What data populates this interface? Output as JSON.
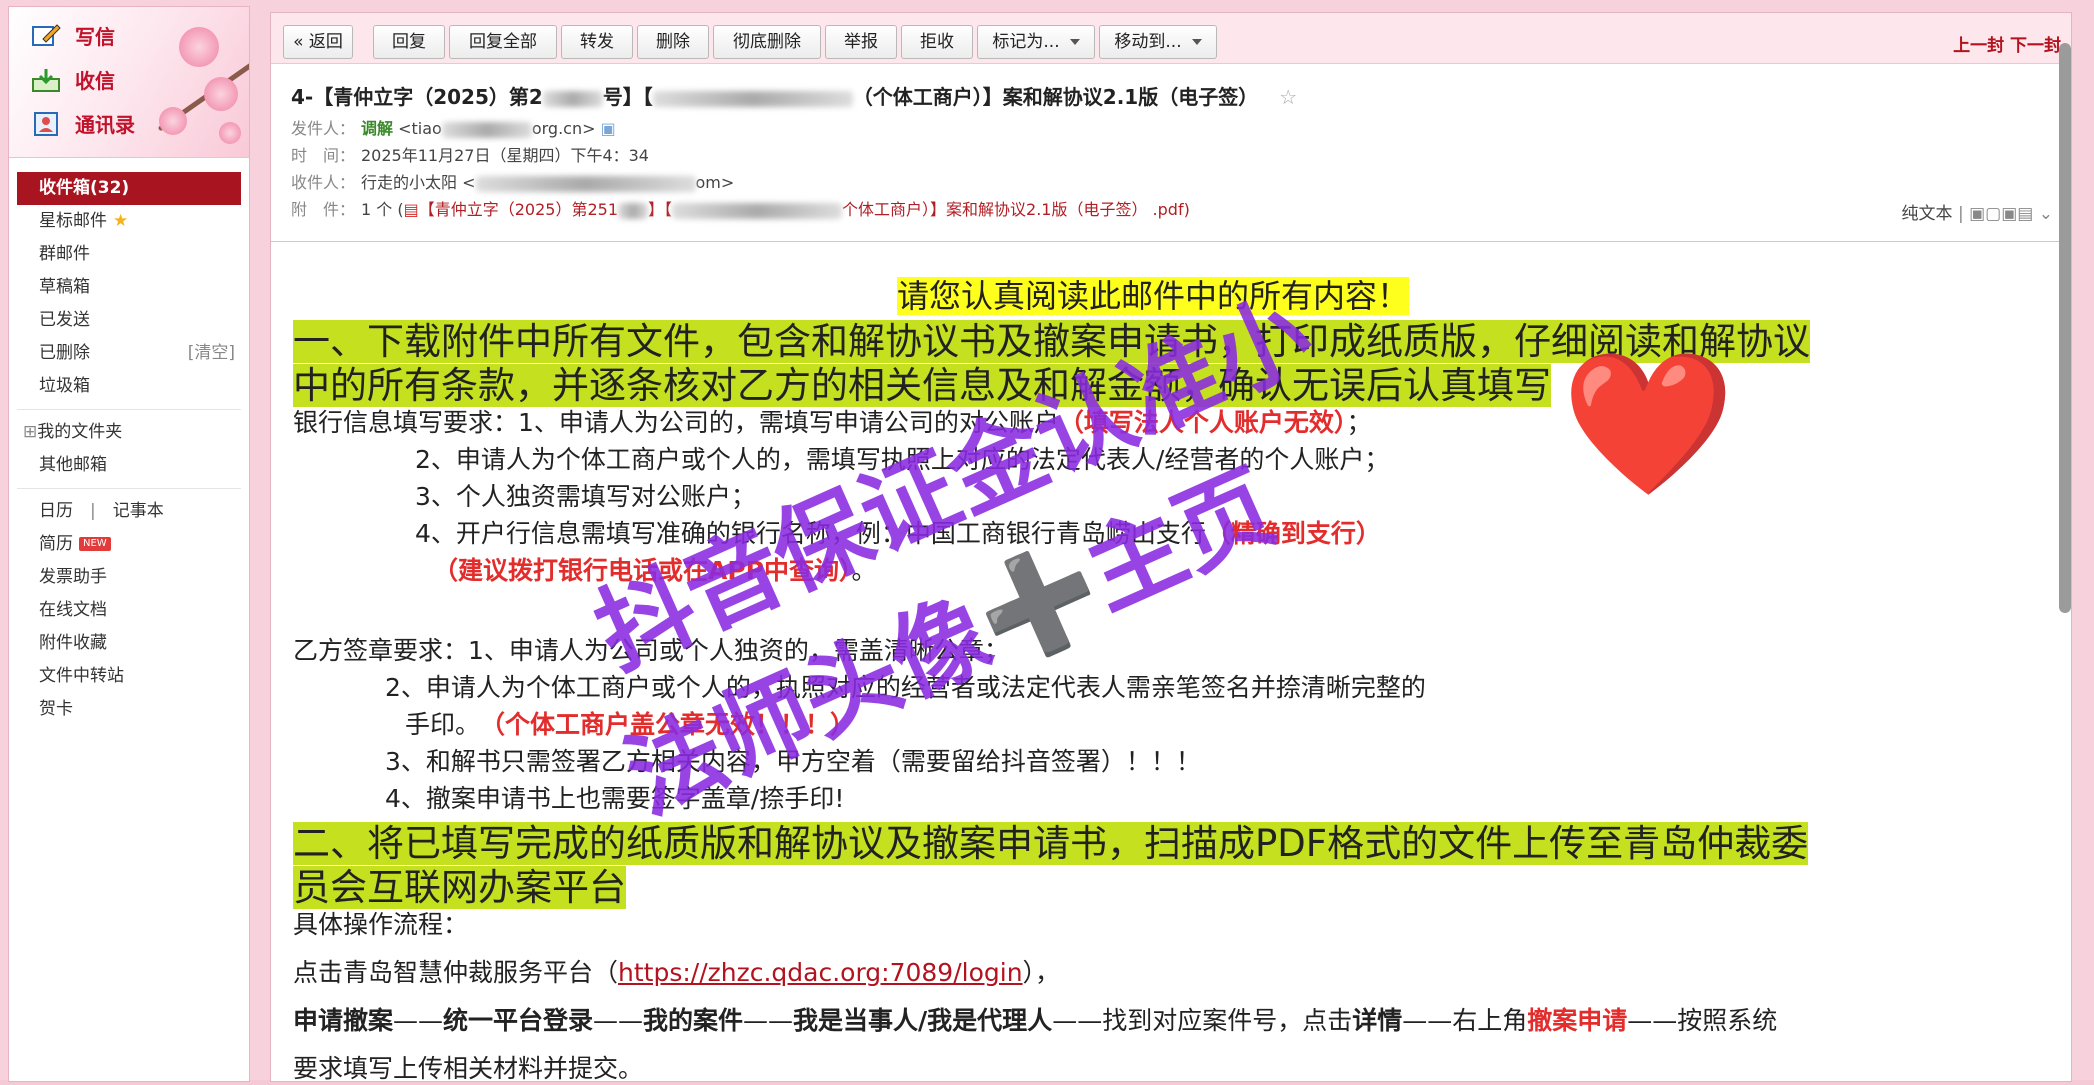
{
  "sidebar": {
    "write": "写信",
    "inbox": "收信",
    "contacts": "通讯录",
    "folders": [
      {
        "label": "收件箱(32)",
        "active": true
      },
      {
        "label": "星标邮件"
      },
      {
        "label": "群邮件"
      },
      {
        "label": "草稿箱"
      },
      {
        "label": "已发送"
      },
      {
        "label": "已删除",
        "extra": "[清空]"
      },
      {
        "label": "垃圾箱"
      }
    ],
    "my_folders": "我的文件夹",
    "other_mail": "其他邮箱",
    "calendar": "日历",
    "notes": "记事本",
    "resume": "简历",
    "resume_badge": "NEW",
    "tools": [
      "发票助手",
      "在线文档",
      "附件收藏",
      "文件中转站",
      "贺卡"
    ]
  },
  "toolbar": {
    "back": "« 返回",
    "reply": "回复",
    "reply_all": "回复全部",
    "forward": "转发",
    "delete": "删除",
    "delete_perm": "彻底删除",
    "report": "举报",
    "reject": "拒收",
    "mark_as": "标记为...",
    "move_to": "移动到...",
    "prev": "上一封",
    "next": "下一封"
  },
  "email": {
    "subject_a": "4-【青仲立字（2025）第2",
    "subject_b": "号】【",
    "subject_c": "（个体工商户）】案和解协议2.1版（电子签）",
    "sender_label": "发件人：",
    "sender_name": "调解",
    "sender_addr_a": "<tiao",
    "sender_addr_b": "org.cn>",
    "time_label": "时　间：",
    "time_value": "2025年11月27日（星期四）下午4：34",
    "to_label": "收件人：",
    "to_name": "行走的小太阳 <",
    "to_addr_b": "om>",
    "attach_label": "附　件：",
    "attach_count": "1 个 (",
    "attach_name_a": "【青仲立字（2025）第251",
    "attach_name_b": "】【",
    "attach_name_c": "个体工商户）】案和解协议2.1版（电子签）  .pdf)",
    "plain_text": "纯文本"
  },
  "body": {
    "notice": "请您认真阅读此邮件中的所有内容！",
    "s1_l1": "一、下载附件中所有文件，包含和解协议书及撤案申请书，打印成纸质版，仔细阅读和解协议",
    "s1_l2": "中的所有条款，并逐条核对乙方的相关信息及和解金额，确认无误后认真填写",
    "bank_1a": "银行信息填写要求：1、申请人为公司的，需填写申请公司的对公账户",
    "bank_1b": "（填写法人个人账户无效）",
    "bank_1c": "；",
    "bank_2": "2、申请人为个体工商户或个人的，需填写执照上对应的法定代表人/经营者的个人账户；",
    "bank_3": "3、个人独资需填写对公账户；",
    "bank_4a": "4、开户行信息需填写准确的银行名称，例：中国工商银行青岛崂山支行",
    "bank_4b": "（精确到支行）",
    "bank_5a": "（建议拨打银行电话或在APP中查询）",
    "bank_5b": "。",
    "seal_1": "乙方签章要求：1、申请人为公司或个人独资的，需盖清晰公章；",
    "seal_2": "2、申请人为个体工商户或个人的，执照对应的经营者或法定代表人需亲笔签名并捺清晰完整的",
    "seal_2b_a": "手印。",
    "seal_2b_b": "（个体工商户盖公章无效！！！）",
    "seal_3": "3、和解书只需签署乙方相关内容，甲方空着（需要留给抖音签署）！！！",
    "seal_4": "4、撤案申请书上也需要签字盖章/捺手印!",
    "s2_l1": "二、将已填写完成的纸质版和解协议及撤案申请书，扫描成PDF格式的文件上传至青岛仲裁委",
    "s2_l2": "员会互联网办案平台",
    "proc": "具体操作流程：",
    "click_a": "点击青岛智慧仲裁服务平台（",
    "click_link": "https://zhzc.qdac.org:7089/login",
    "click_b": "），",
    "flow": {
      "a": "申请撤案",
      "d1": "——",
      "b": "统一平台登录",
      "d2": "——",
      "c": "我的案件",
      "d3": "——",
      "d": "我是当事人/我是代理人",
      "e": "——找到对应案件号，点击",
      "f": "详情",
      "g": "——右上角",
      "h": "撤案申请",
      "i": "——按照系统"
    },
    "flow_2": "要求填写上传相关材料并提交。"
  },
  "watermark": {
    "line1": "抖音保证金认准小",
    "line2": "法师头像➕主页",
    "emoji": "❤️"
  }
}
